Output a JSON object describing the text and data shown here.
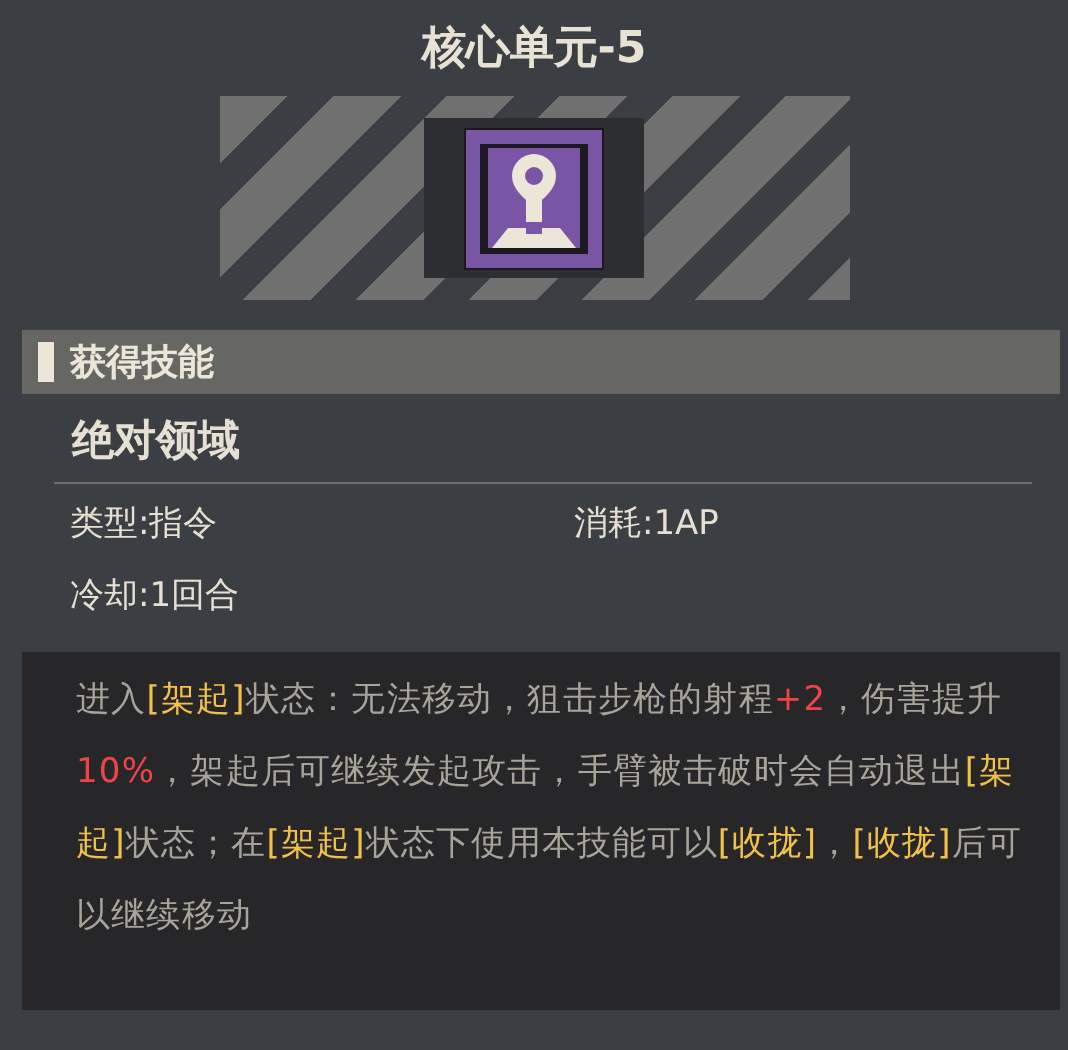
{
  "title": "核心单元-5",
  "section": {
    "label": "获得技能"
  },
  "skill": {
    "name": "绝对领域",
    "stats": [
      {
        "label": "类型:指令"
      },
      {
        "label": "消耗:1AP"
      },
      {
        "label": "冷却:1回合"
      }
    ],
    "description": [
      {
        "kind": "plain",
        "text": "进入"
      },
      {
        "kind": "keyword",
        "text": "[架起]"
      },
      {
        "kind": "plain",
        "text": "状态：无法移动，狙击步枪的射程"
      },
      {
        "kind": "value",
        "text": "+2"
      },
      {
        "kind": "plain",
        "text": "，伤害提升"
      },
      {
        "kind": "value",
        "text": "10%"
      },
      {
        "kind": "plain",
        "text": "，架起后可继续发起攻击，手臂被击破时会自动退出"
      },
      {
        "kind": "keyword",
        "text": "[架起]"
      },
      {
        "kind": "plain",
        "text": "状态；在"
      },
      {
        "kind": "keyword",
        "text": "[架起]"
      },
      {
        "kind": "plain",
        "text": "状态下使用本技能可以"
      },
      {
        "kind": "keyword",
        "text": "[收拢]"
      },
      {
        "kind": "plain",
        "text": "，"
      },
      {
        "kind": "keyword",
        "text": "[收拢]"
      },
      {
        "kind": "plain",
        "text": "后可以继续移动"
      }
    ]
  }
}
